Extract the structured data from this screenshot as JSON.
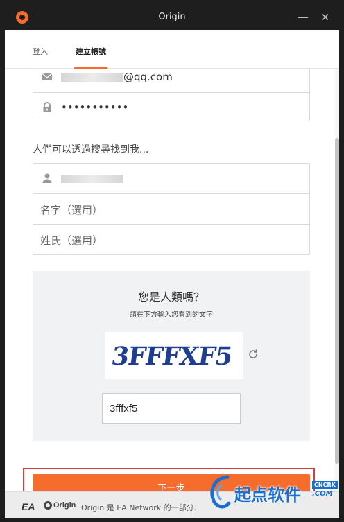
{
  "window": {
    "title": "Origin"
  },
  "tabs": [
    {
      "label": "登入",
      "active": false
    },
    {
      "label": "建立帳號",
      "active": true
    }
  ],
  "account": {
    "email_visible": "@qq.com",
    "password_mask": "•••••••••••"
  },
  "hint": "人們可以透過搜尋找到我...",
  "profile": {
    "first_name_placeholder": "名字（選用）",
    "last_name_placeholder": "姓氏（選用）"
  },
  "captcha": {
    "title": "您是人類嗎？",
    "subtitle": "請在下方輸入您看到的文字",
    "image_text": "3FFFXF5",
    "input_value": "3fffxf5"
  },
  "next_button_label": "下一步",
  "footer": {
    "ea_logo": "EA",
    "origin_logo": "Origin",
    "text": "Origin 是 EA Network 的一部分."
  },
  "watermark": {
    "text": "起点软件",
    "tag": "CNCRK",
    "domain": ".COM"
  },
  "colors": {
    "accent": "#f56c2d",
    "highlight": "#d93a3a",
    "watermark": "#1a6fd0"
  }
}
